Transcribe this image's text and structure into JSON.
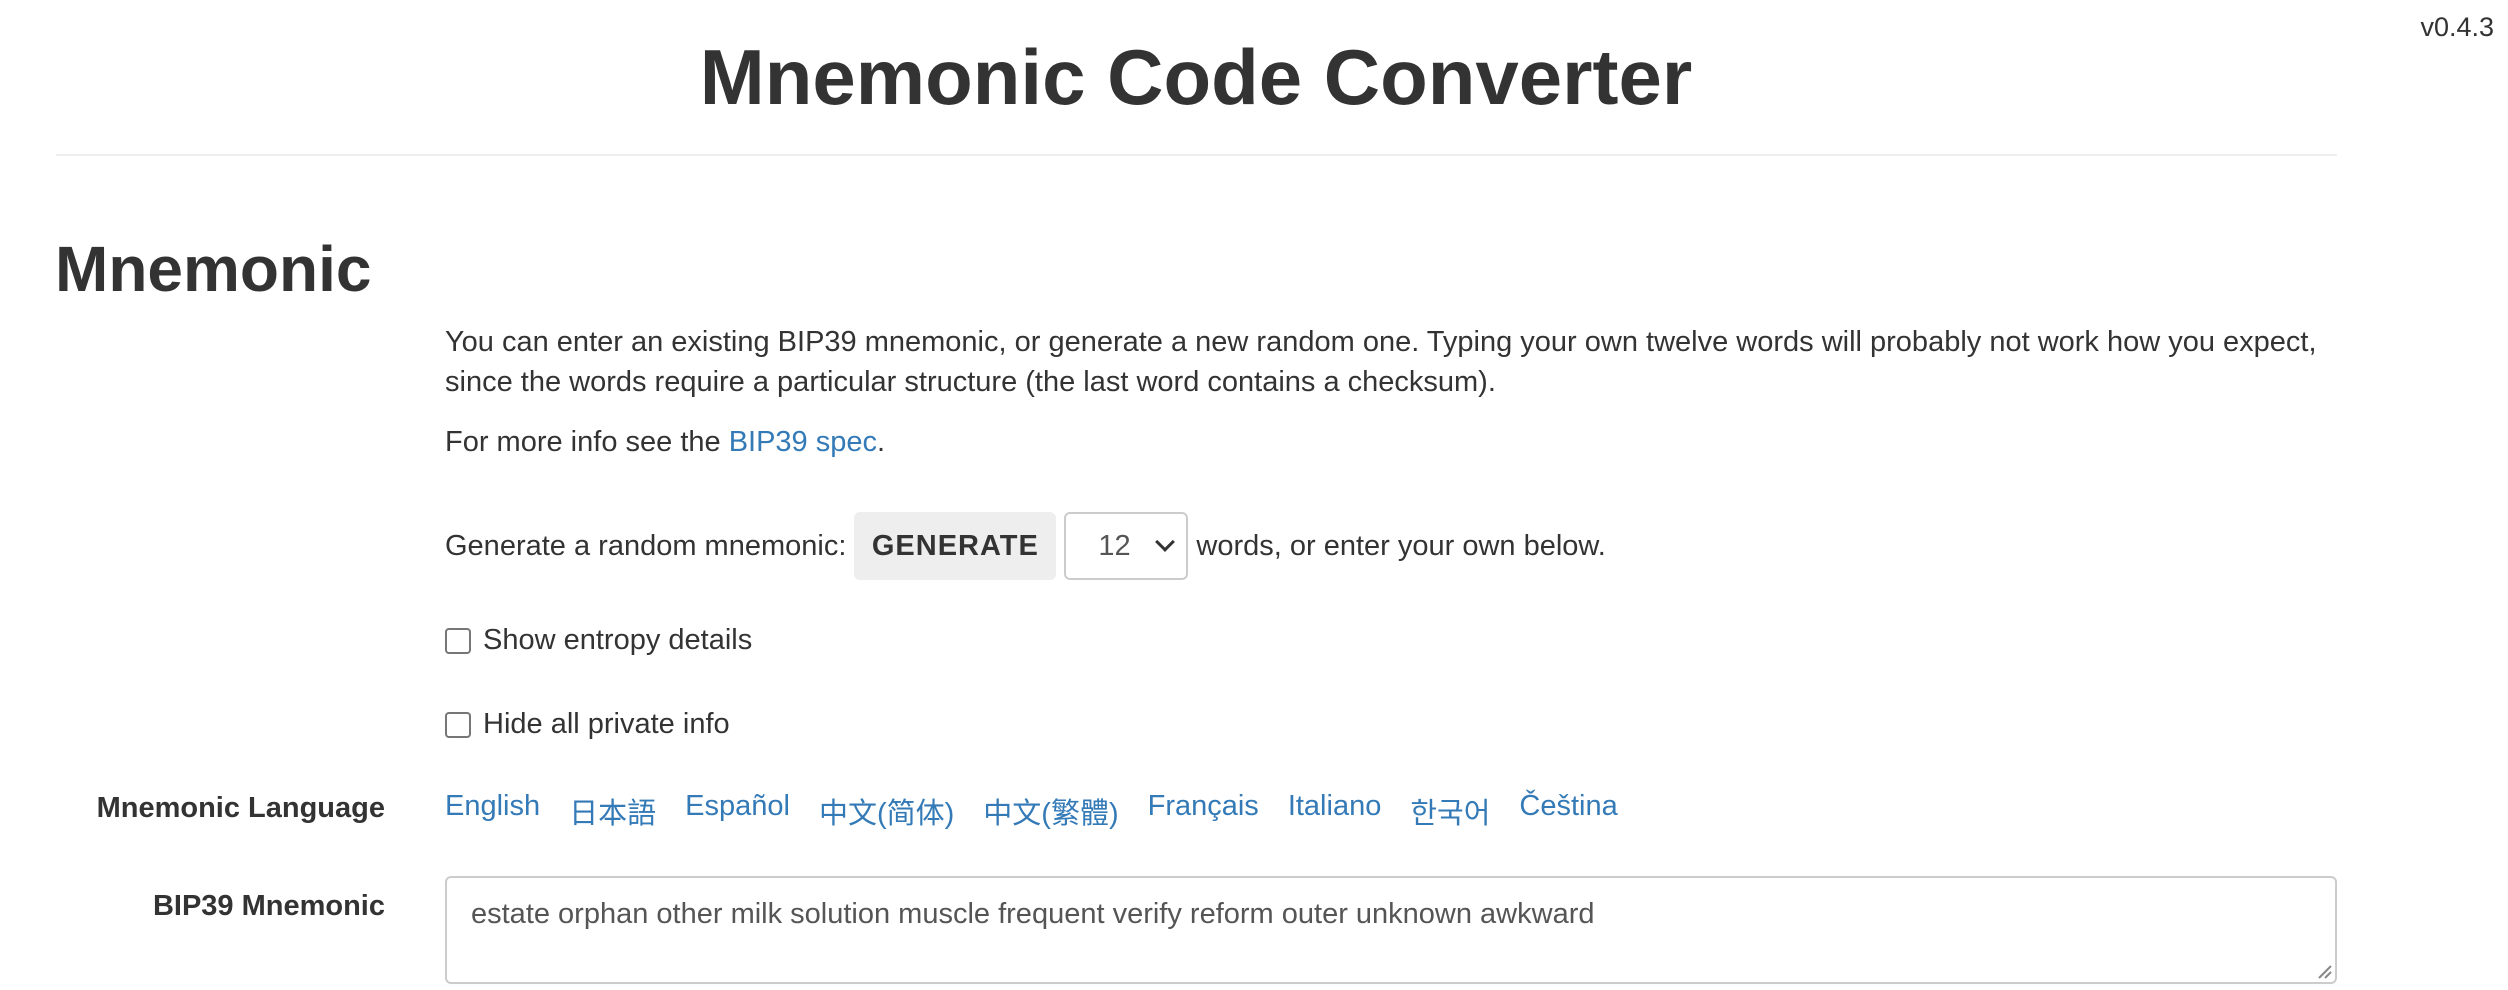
{
  "app": {
    "version": "v0.4.3",
    "title": "Mnemonic Code Converter"
  },
  "mnemonic_section": {
    "heading": "Mnemonic",
    "description": "You can enter an existing BIP39 mnemonic, or generate a new random one. Typing your own twelve words will probably not work how you expect, since the words require a particular structure (the last word contains a checksum).",
    "more_info_prefix": "For more info see the ",
    "more_info_link": "BIP39 spec",
    "more_info_suffix": ".",
    "generate_label": "Generate a random mnemonic:",
    "generate_button": "GENERATE",
    "word_count": "12",
    "generate_suffix": "words, or enter your own below.",
    "show_entropy_label": "Show entropy details",
    "show_entropy_checked": false,
    "hide_private_label": "Hide all private info",
    "hide_private_checked": false,
    "language_label": "Mnemonic Language",
    "languages": [
      "English",
      "日本語",
      "Español",
      "中文(简体)",
      "中文(繁體)",
      "Français",
      "Italiano",
      "한국어",
      "Čeština"
    ],
    "bip39_label": "BIP39 Mnemonic",
    "bip39_value": "estate orphan other milk solution muscle frequent verify reform outer unknown awkward"
  },
  "colors": {
    "link": "#337ab7",
    "text": "#333333",
    "button_bg": "#eeeeee",
    "border": "#cccccc"
  }
}
